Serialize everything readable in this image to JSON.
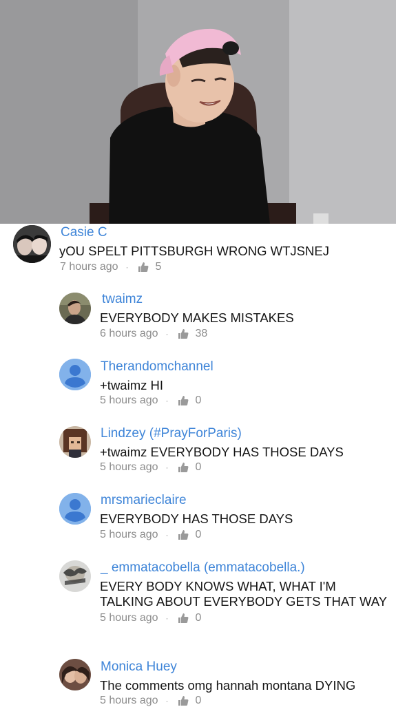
{
  "video": {
    "description_icon": "video-frame"
  },
  "comments": [
    {
      "author": "Casie C",
      "text": "yOU SPELT PITTSBURGH WRONG WTJSNEJ",
      "time": "7 hours ago",
      "likes": "5",
      "avatar": "photo-avatar"
    },
    {
      "author": "twaimz",
      "text": "EVERYBODY MAKES MISTAKES",
      "time": "6 hours ago",
      "likes": "38",
      "avatar": "photo-avatar"
    },
    {
      "author": "Therandomchannel",
      "text": "+twaimz HI",
      "time": "5 hours ago",
      "likes": "0",
      "avatar": "default-avatar"
    },
    {
      "author": "Lindzey (#PrayForParis)",
      "text": "+twaimz EVERYBODY HAS THOSE DAYS",
      "time": "5 hours ago",
      "likes": "0",
      "avatar": "pixel-avatar"
    },
    {
      "author": "mrsmarieclaire",
      "text": "EVERYBODY HAS THOSE DAYS",
      "time": "5 hours ago",
      "likes": "0",
      "avatar": "default-avatar"
    },
    {
      "author": "_ emmatacobella (emmatacobella.)",
      "text_line1": "EVERY BODY KNOWS WHAT, WHAT I'M",
      "text_line2": "TALKING ABOUT EVERYBODY GETS THAT WAY",
      "time": "5 hours ago",
      "likes": "0",
      "avatar": "photo-avatar"
    },
    {
      "author": "Monica Huey",
      "text": "The comments omg hannah montana DYING",
      "time": "5 hours ago",
      "likes": "0",
      "avatar": "photo-avatar"
    }
  ],
  "colors": {
    "author": "#3f85d8",
    "text": "#151515",
    "meta": "#8c8c8c"
  }
}
